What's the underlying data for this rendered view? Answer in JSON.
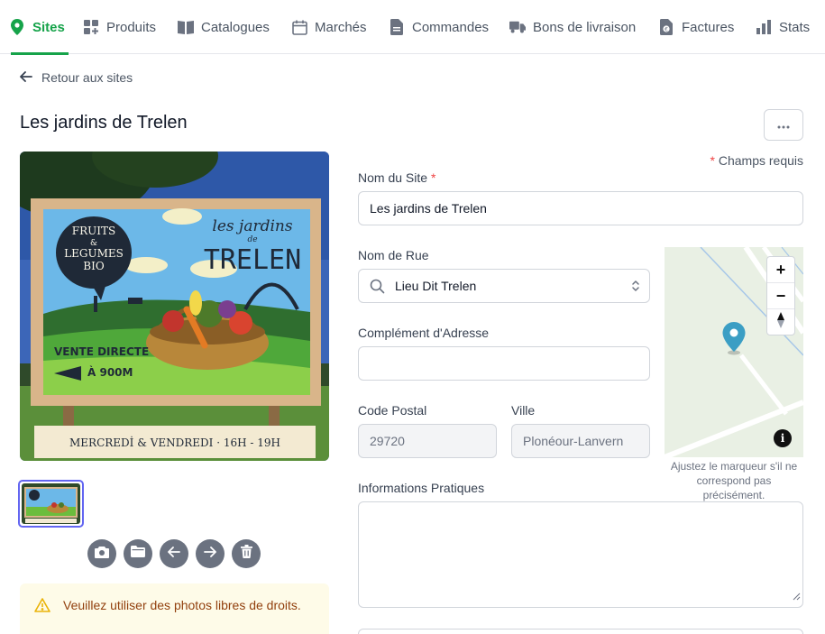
{
  "nav": {
    "items": [
      {
        "label": "Sites",
        "icon": "map-pin-icon",
        "active": true
      },
      {
        "label": "Produits",
        "icon": "grid-plus-icon"
      },
      {
        "label": "Catalogues",
        "icon": "book-icon"
      },
      {
        "label": "Marchés",
        "icon": "calendar-icon"
      },
      {
        "label": "Commandes",
        "icon": "document-icon"
      },
      {
        "label": "Bons de livraison",
        "icon": "truck-icon"
      },
      {
        "label": "Factures",
        "icon": "euro-file-icon"
      },
      {
        "label": "Stats",
        "icon": "bar-chart-icon"
      }
    ]
  },
  "back": {
    "label": "Retour aux sites"
  },
  "page": {
    "title": "Les jardins de Trelen",
    "required_note": "Champs requis"
  },
  "photo": {
    "sign_bubble": [
      "FRUITS",
      "&",
      "LEGUMES",
      "BIO"
    ],
    "sign_brand_top": "les jardins",
    "sign_brand_mid": "de",
    "sign_brand_name": "TRELEN",
    "sign_sale": [
      "VENTE DIRECTE",
      "À 900M"
    ],
    "sign_days": "MERCREDİ & VENDREDI · 16H - 19H"
  },
  "warning": {
    "text": "Veuillez utiliser des photos libres de droits."
  },
  "form": {
    "site_name": {
      "label": "Nom du Site",
      "value": "Les jardins de Trelen"
    },
    "street": {
      "label": "Nom de Rue",
      "value": "Lieu Dit Trelen"
    },
    "address_extra": {
      "label": "Complément d'Adresse",
      "value": ""
    },
    "postal_code": {
      "label": "Code Postal",
      "value": "29720"
    },
    "city": {
      "label": "Ville",
      "value": "Plonéour-Lanvern"
    },
    "info": {
      "label": "Informations Pratiques",
      "value": ""
    }
  },
  "map": {
    "zoom_in": "+",
    "zoom_out": "−",
    "info": "i",
    "hint": "Ajustez le marqueur s'il ne correspond pas précisément.",
    "marker_color": "#3b9ec4"
  },
  "colors": {
    "accent": "#16a34a",
    "required": "#ef4444",
    "warning_bg": "#fefbe8"
  }
}
